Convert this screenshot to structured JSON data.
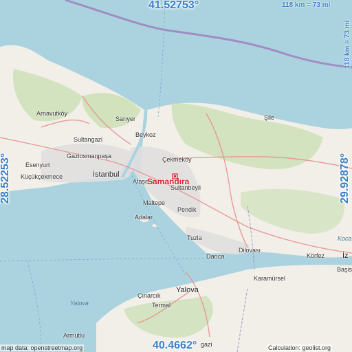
{
  "coordinates": {
    "top": "41.52753°",
    "bottom": "40.4662°",
    "left": "28.52253°",
    "right": "29.92878°"
  },
  "scale": {
    "horizontal": "118 km = 73 mi",
    "vertical": "118 km = 73 mi"
  },
  "places": {
    "highlight": "Samandıra",
    "istanbul": "İstanbul",
    "arnavutkoy": "Arnavutköy",
    "sariyer": "Sarıyer",
    "sultangazi": "Sultangazi",
    "beykoz": "Beykoz",
    "gaziosmanpasa": "Gaziosmanpaşa",
    "cekmekoy": "Çekmeköy",
    "esenyurt": "Esenyurt",
    "kucukcekmece": "Küçükçekmece",
    "atasehir": "Ataşehir",
    "sultanbeyli": "Sultanbeyli",
    "maltepe": "Maltepe",
    "pendik": "Pendik",
    "adalar": "Adalar",
    "tuzla": "Tuzla",
    "darica": "Darıca",
    "dilovasi": "Dilovası",
    "korfez": "Körfez",
    "izmit": "İz",
    "basis": "Başis",
    "karamursel": "Karamürsel",
    "yalova_city": "Yalova",
    "cinarcik": "Çınarcık",
    "termal": "Termal",
    "yalova_region": "Yalova",
    "kocaeli": "Koca",
    "armutlu": "Armutlu",
    "sile": "Şile",
    "gazi": "gazi"
  },
  "attribution": {
    "map_data": "map data: openstreetmap.org",
    "calculation": "Calculation: geolist.org"
  },
  "colors": {
    "sea": "#aad3df",
    "land": "#f2efe9",
    "forest": "#c8deb0",
    "urban": "#e0dfdf",
    "roads": "#e8928f",
    "boundary": "#a07fc0",
    "accent": "#3a7fc9",
    "highlight": "#d6242f"
  }
}
